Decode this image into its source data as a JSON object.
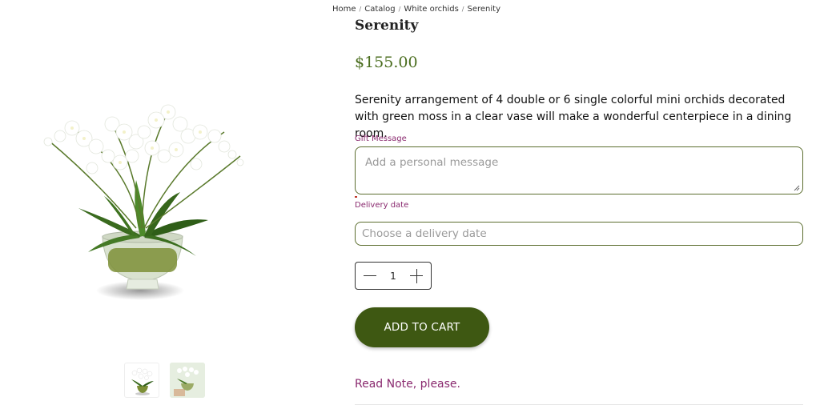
{
  "breadcrumb": [
    "Home",
    "Catalog",
    "White orchids",
    "Serenity"
  ],
  "product": {
    "title": "Serenity",
    "price": "$155.00",
    "description": "Serenity arrangement of 4 double or 6 single colorful mini orchids decorated with green moss in a clear vase will make a wonderful centerpiece in a dining room."
  },
  "form": {
    "gift_label": "Gift Message",
    "gift_placeholder": "Add a personal message",
    "date_label": "Delivery date",
    "date_placeholder": "Choose a delivery date"
  },
  "quantity": "1",
  "actions": {
    "add_to_cart": "ADD TO CART",
    "read_note": "Read Note, please."
  },
  "icons": {
    "minus": "minus-icon",
    "plus": "plus-icon"
  },
  "colors": {
    "accent_green": "#3e5812",
    "price_green": "#4a6d1e",
    "label_purple": "#8a2a6f",
    "field_border": "#5c6e2f"
  }
}
